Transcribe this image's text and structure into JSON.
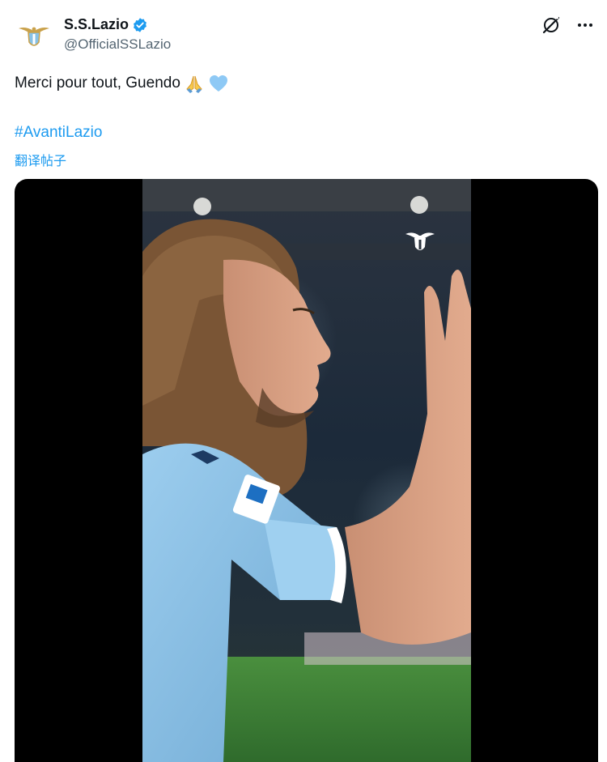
{
  "account": {
    "display_name": "S.S.Lazio",
    "handle": "@OfficialSSLazio",
    "verified": true,
    "avatar_icon": "lazio-eagle-crest-icon"
  },
  "actions": {
    "grok_icon": "grok-icon",
    "more_icon": "more-options-icon",
    "more_label": "···"
  },
  "tweet": {
    "text": "Merci pour tout, Guendo",
    "emojis": [
      "folded-hands-icon",
      "light-blue-heart-icon"
    ],
    "hashtag": "#AvantiLazio",
    "translate_label": "翻译帖子"
  },
  "media": {
    "type": "video",
    "watermark_icon": "lazio-eagle-watermark-icon",
    "shirt_color": "#87c1e6",
    "pitch_color": "#3f8a3d"
  }
}
